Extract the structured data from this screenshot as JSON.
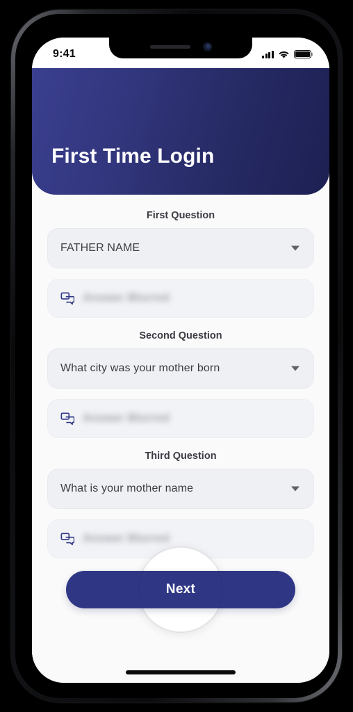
{
  "status_bar": {
    "time": "9:41",
    "cellular_icon": "cellular-signal-icon",
    "wifi_icon": "wifi-icon",
    "battery_icon": "battery-full-icon"
  },
  "header": {
    "title": "First Time Login",
    "gradient_from": "#3a3f8f",
    "gradient_to": "#1d2052"
  },
  "form": {
    "questions": [
      {
        "label": "First Question",
        "selected": "FATHER NAME",
        "answer_placeholder": "Answer",
        "answer_value": "Answer Blurred",
        "icon": "chat-bubbles-icon"
      },
      {
        "label": "Second Question",
        "selected": "What city was your mother born",
        "answer_placeholder": "Answer",
        "answer_value": "Answer Blurred",
        "icon": "chat-bubbles-icon"
      },
      {
        "label": "Third Question",
        "selected": "What is your mother name",
        "answer_placeholder": "Answer",
        "answer_value": "Answer Blurred",
        "icon": "chat-bubbles-icon"
      }
    ]
  },
  "actions": {
    "next_label": "Next",
    "next_color": "#2f3785"
  }
}
